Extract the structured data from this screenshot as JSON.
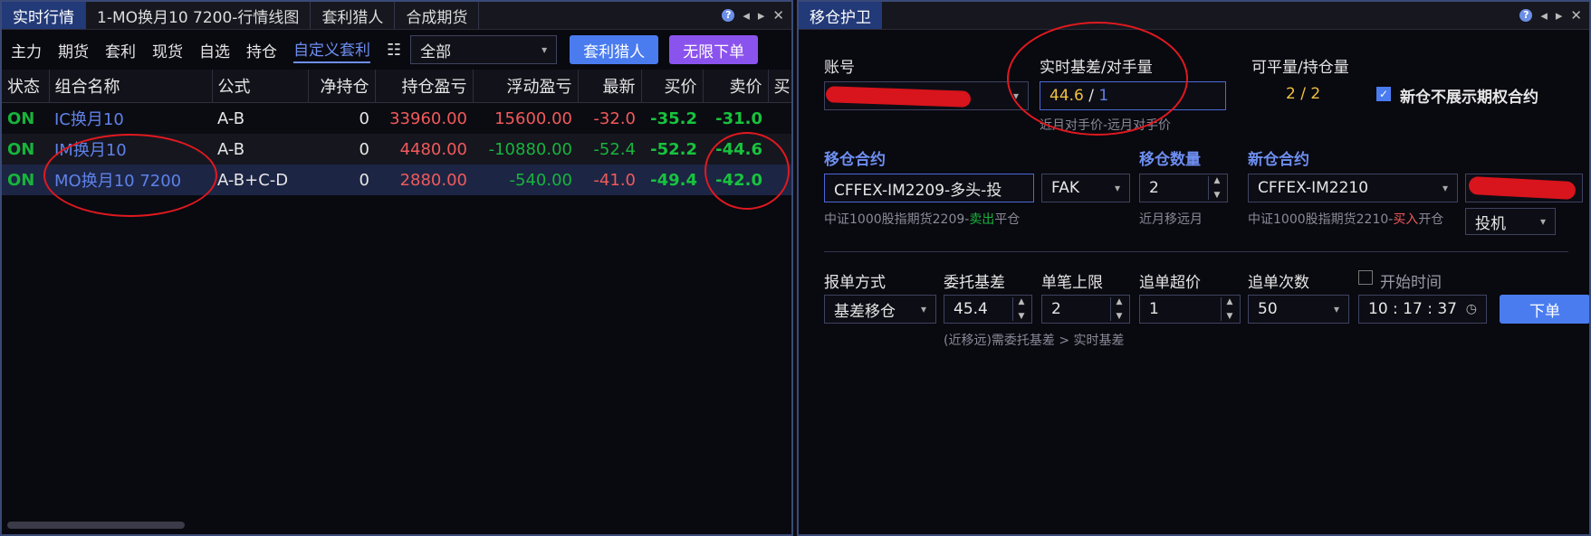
{
  "left": {
    "tabs": [
      "实时行情",
      "1-MO换月10 7200-行情线图",
      "套利猎人",
      "合成期货"
    ],
    "categories": [
      "主力",
      "期货",
      "套利",
      "现货",
      "自选",
      "持仓",
      "自定义套利"
    ],
    "filter": "全部",
    "btn_hunter": "套利猎人",
    "btn_unlimited": "无限下单",
    "columns": [
      "状态",
      "组合名称",
      "公式",
      "净持仓",
      "持仓盈亏",
      "浮动盈亏",
      "最新",
      "买价",
      "卖价",
      "买"
    ],
    "rows": [
      {
        "status": "ON",
        "name": "IC换月10",
        "formula": "A-B",
        "net": "0",
        "pos_pnl": "33960.00",
        "float_pnl": "15600.00",
        "last": "-32.0",
        "bid": "-35.2",
        "ask": "-31.0"
      },
      {
        "status": "ON",
        "name": "IM换月10",
        "formula": "A-B",
        "net": "0",
        "pos_pnl": "4480.00",
        "float_pnl": "-10880.00",
        "last": "-52.4",
        "bid": "-52.2",
        "ask": "-44.6"
      },
      {
        "status": "ON",
        "name": "MO换月10 7200",
        "formula": "A-B+C-D",
        "net": "0",
        "pos_pnl": "2880.00",
        "float_pnl": "-540.00",
        "last": "-41.0",
        "bid": "-49.4",
        "ask": "-42.0"
      }
    ]
  },
  "right": {
    "tab": "移仓护卫",
    "account_label": "账号",
    "basis_label": "实时基差/对手量",
    "basis_value": "44.6",
    "basis_sep": " / ",
    "basis_qty": "1",
    "basis_sub": "近月对手价-远月对手价",
    "closable_label": "可平量/持仓量",
    "closable_value": "2 / 2",
    "no_option_label": "新仓不展示期权合约",
    "move_contract_label": "移仓合约",
    "move_contract_value": "CFFEX-IM2209-多头-投",
    "order_type": "FAK",
    "move_qty_label": "移仓数量",
    "move_qty_value": "2",
    "new_contract_label": "新仓合约",
    "new_contract_value": "CFFEX-IM2210",
    "move_sub_a": "中证1000股指期货2209-",
    "move_sub_b": "卖出",
    "move_sub_c": "平仓",
    "qty_sub": "近月移远月",
    "new_sub_a": "中证1000股指期货2210-",
    "new_sub_b": "买入",
    "new_sub_c": "开仓",
    "hedge_value": "投机",
    "quote_method_label": "报单方式",
    "quote_method_value": "基差移仓",
    "entrust_basis_label": "委托基差",
    "entrust_basis_value": "45.4",
    "single_limit_label": "单笔上限",
    "single_limit_value": "2",
    "chase_price_label": "追单超价",
    "chase_price_value": "1",
    "chase_times_label": "追单次数",
    "chase_times_value": "50",
    "start_time_label": "开始时间",
    "time_value": "10 : 17 : 37",
    "submit_label": "下单",
    "condition_text": "(近移远)需委托基差 > 实时基差"
  }
}
